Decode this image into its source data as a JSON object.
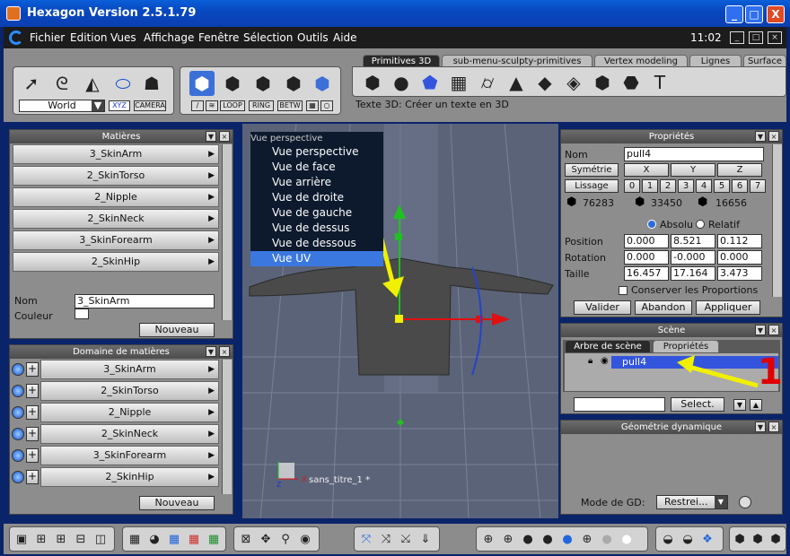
{
  "window": {
    "title": "Hexagon Version 2.5.1.79",
    "buttons": [
      "_",
      "□",
      "X"
    ]
  },
  "menubar": {
    "items": [
      "Fichier",
      "Edition",
      "Vues",
      "Affichage",
      "Fenêtre",
      "Sélection",
      "Outils",
      "Aide"
    ],
    "clock": "11:02"
  },
  "toolbar": {
    "world_select": "World",
    "xyz": "XYZ",
    "camera": "CAMERA",
    "loop": "LOOP",
    "ring": "RING",
    "betw": "BETW",
    "tabs": [
      "Primitives 3D",
      "sub-menu-sculpty-primitives",
      "Vertex modeling",
      "Lignes",
      "Surface"
    ],
    "hint": "Texte 3D: Créer un texte en 3D"
  },
  "materials": {
    "title": "Matières",
    "items": [
      "3_SkinArm",
      "2_SkinTorso",
      "2_Nipple",
      "2_SkinNeck",
      "3_SkinForearm",
      "2_SkinHip"
    ],
    "nom_label": "Nom",
    "nom_value": "3_SkinArm",
    "couleur_label": "Couleur",
    "new_button": "Nouveau"
  },
  "domain": {
    "title": "Domaine de matières",
    "items": [
      "3_SkinArm",
      "2_SkinTorso",
      "2_Nipple",
      "2_SkinNeck",
      "3_SkinForearm",
      "2_SkinHip"
    ],
    "new_button": "Nouveau"
  },
  "viewport": {
    "menu_title": "Vue perspective",
    "menu_items": [
      "Vue perspective",
      "Vue de face",
      "Vue arrière",
      "Vue de droite",
      "Vue de gauche",
      "Vue de dessus",
      "Vue de dessous",
      "Vue UV"
    ],
    "selected": "Vue UV",
    "doc_label": "sans_titre_1 *",
    "axis_x": "X",
    "axis_z": "Z"
  },
  "properties": {
    "title": "Propriétés",
    "nom_label": "Nom",
    "nom_value": "pull4",
    "symetrie": "Symétrie",
    "lissage": "Lissage",
    "axes": [
      "X",
      "Y",
      "Z"
    ],
    "lissage_levels": [
      "0",
      "1",
      "2",
      "3",
      "4",
      "5",
      "6",
      "7"
    ],
    "counts": [
      "76283",
      "33450",
      "16656"
    ],
    "absolu": "Absolu",
    "relatif": "Relatif",
    "position_label": "Position",
    "position": [
      "0.000",
      "8.521",
      "0.112"
    ],
    "rotation_label": "Rotation",
    "rotation": [
      "0.000",
      "-0.000",
      "0.000"
    ],
    "taille_label": "Taille",
    "taille": [
      "16.457",
      "17.164",
      "3.473"
    ],
    "conserver": "Conserver les Proportions",
    "valider": "Valider",
    "abandon": "Abandon",
    "appliquer": "Appliquer"
  },
  "scene": {
    "title": "Scène",
    "tab_tree": "Arbre de scène",
    "tab_props": "Propriétés",
    "item": "pull4",
    "select_button": "Select.",
    "annotation": "1"
  },
  "geometry": {
    "title": "Géométrie dynamique",
    "mode_label": "Mode de GD:",
    "mode_value": "Restrei..."
  },
  "colors": {
    "annotation_arrow": "#f0f000",
    "annotation_number": "#e00000",
    "selection": "#3355dd"
  }
}
